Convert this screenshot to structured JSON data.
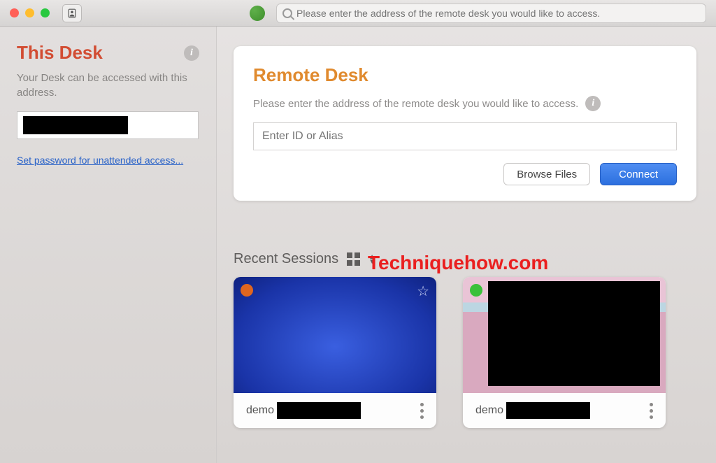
{
  "titlebar": {
    "search_placeholder": "Please enter the address of the remote desk you would like to access."
  },
  "sidebar": {
    "title": "This Desk",
    "description": "Your Desk can be accessed with this address.",
    "set_password_label": "Set password for unattended access..."
  },
  "remote": {
    "title": "Remote Desk",
    "description": "Please enter the address of the remote desk you would like to access.",
    "input_placeholder": "Enter ID or Alias",
    "browse_label": "Browse Files",
    "connect_label": "Connect"
  },
  "watermark": "Techniquehow.com",
  "recent": {
    "title": "Recent Sessions",
    "items": [
      {
        "name_prefix": "demo"
      },
      {
        "name_prefix": "demo"
      }
    ]
  }
}
